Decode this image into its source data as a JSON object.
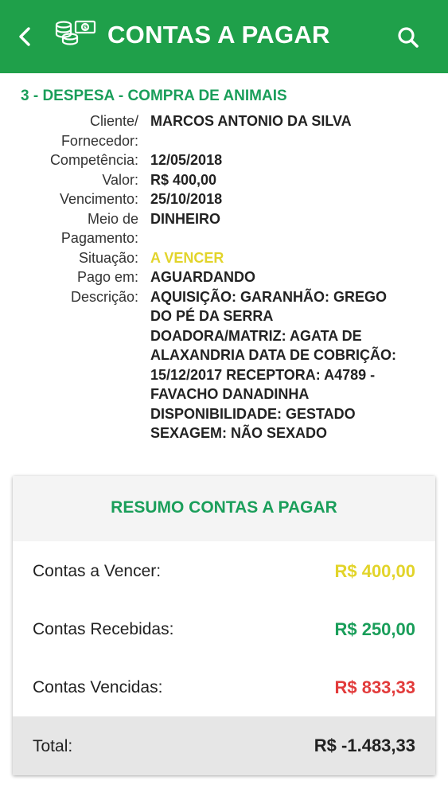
{
  "colors": {
    "appbar": "#1fa04a",
    "accent_green": "#1a9e5a",
    "warning_yellow": "#e2d42a",
    "danger_red": "#e23b3b",
    "text_dark": "#222222"
  },
  "appbar": {
    "title": "CONTAS A PAGAR",
    "back_icon": "chevron-left-icon",
    "money_icon": "money-stack-icon",
    "search_icon": "search-icon"
  },
  "record": {
    "title": "3 - DESPESA - COMPRA DE ANIMAIS",
    "fields": [
      {
        "label_lines": [
          "Cliente/",
          "Fornecedor:"
        ],
        "value_lines": [
          "MARCOS ANTONIO DA SILVA"
        ],
        "style": "normal"
      },
      {
        "label_lines": [
          "Competência:"
        ],
        "value_lines": [
          "12/05/2018"
        ],
        "style": "normal"
      },
      {
        "label_lines": [
          "Valor:"
        ],
        "value_lines": [
          "R$ 400,00"
        ],
        "style": "normal"
      },
      {
        "label_lines": [
          "Vencimento:"
        ],
        "value_lines": [
          "25/10/2018"
        ],
        "style": "normal"
      },
      {
        "label_lines": [
          "Meio de",
          "Pagamento:"
        ],
        "value_lines": [
          "DINHEIRO"
        ],
        "style": "normal"
      },
      {
        "label_lines": [
          "Situação:"
        ],
        "value_lines": [
          "A VENCER"
        ],
        "style": "warn"
      },
      {
        "label_lines": [
          "Pago em:"
        ],
        "value_lines": [
          "AGUARDANDO"
        ],
        "style": "normal"
      },
      {
        "label_lines": [
          "Descrição:"
        ],
        "value_lines": [
          "AQUISIÇÃO: GARANHÃO: GREGO",
          "DO PÉ DA SERRA",
          "DOADORA/MATRIZ: AGATA DE",
          "ALAXANDRIA DATA DE COBRIÇÃO:",
          "15/12/2017 RECEPTORA: A4789 -",
          "FAVACHO DANADINHA",
          "DISPONIBILIDADE: GESTADO",
          "SEXAGEM: NÃO SEXADO"
        ],
        "style": "normal"
      }
    ]
  },
  "summary": {
    "title": "RESUMO CONTAS A PAGAR",
    "rows": [
      {
        "label": "Contas a Vencer:",
        "value": "R$ 400,00",
        "color": "#e2d42a"
      },
      {
        "label": "Contas Recebidas:",
        "value": "R$ 250,00",
        "color": "#1a9e5a"
      },
      {
        "label": "Contas Vencidas:",
        "value": "R$ 833,33",
        "color": "#e23b3b"
      }
    ],
    "total_label": "Total:",
    "total_value": "R$ -1.483,33"
  }
}
